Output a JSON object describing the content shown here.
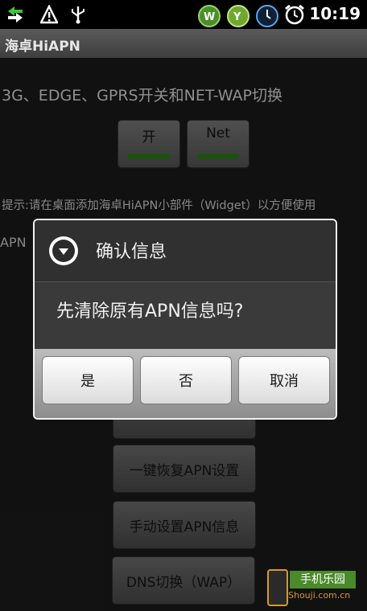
{
  "status_bar": {
    "time": "10:19",
    "icons": [
      "data-transfer-icon",
      "warning-icon",
      "usb-icon",
      "app-w-icon",
      "app-y-icon",
      "clock-circle-icon",
      "alarm-clock-icon"
    ]
  },
  "app": {
    "title": "海卓HiAPN"
  },
  "main": {
    "heading": "3G、EDGE、GPRS开关和NET-WAP切换",
    "toggle_on_label": "开",
    "toggle_net_label": "Net",
    "tip": "提示:请在桌面添加海卓HiAPN小部件（Widget）以方便使用",
    "partial_text": "APN",
    "buttons": [
      "一键恢复APN设置",
      "手动设置APN信息",
      "DNS切换（WAP）"
    ]
  },
  "dialog": {
    "title": "确认信息",
    "message": "先清除原有APN信息吗?",
    "yes_label": "是",
    "no_label": "否",
    "cancel_label": "取消"
  },
  "watermark": {
    "name": "手机乐园",
    "url": "Shouji.com.cn"
  },
  "colors": {
    "toggle_indicator": "#2e7d1a",
    "accent_orange": "#d79a2a"
  }
}
